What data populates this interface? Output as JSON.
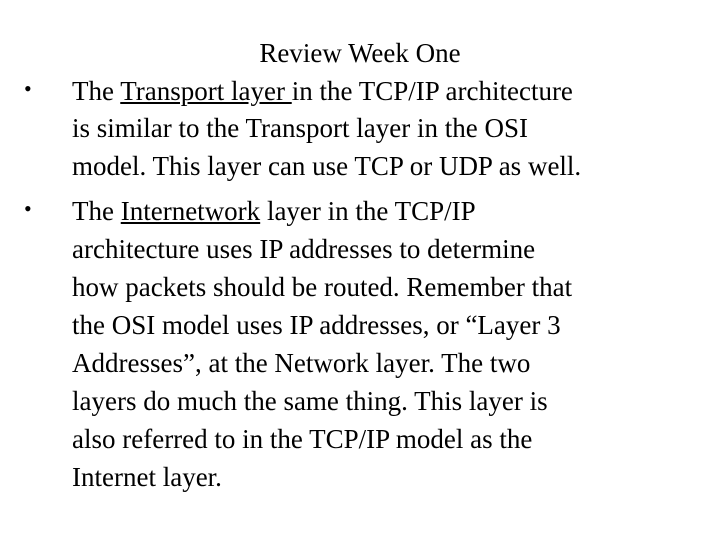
{
  "slide": {
    "title": "Review Week One",
    "bullets": [
      {
        "lines": [
          [
            "The ",
            "Transport layer ",
            "in the TCP/IP architecture"
          ],
          "is similar to the Transport layer in the OSI",
          "model.  This layer can use TCP or UDP as well."
        ]
      },
      {
        "lines": [
          [
            "The ",
            "Internetwork",
            " layer in the TCP/IP"
          ],
          "architecture uses IP addresses to determine",
          "how packets should be routed.  Remember that",
          "the OSI model uses IP addresses, or “Layer 3",
          "Addresses”, at the Network layer.  The two",
          "layers do much the same thing.  This layer is",
          "also referred to in the TCP/IP model as the",
          "Internet layer."
        ]
      }
    ],
    "bullet_glyph": "•"
  }
}
